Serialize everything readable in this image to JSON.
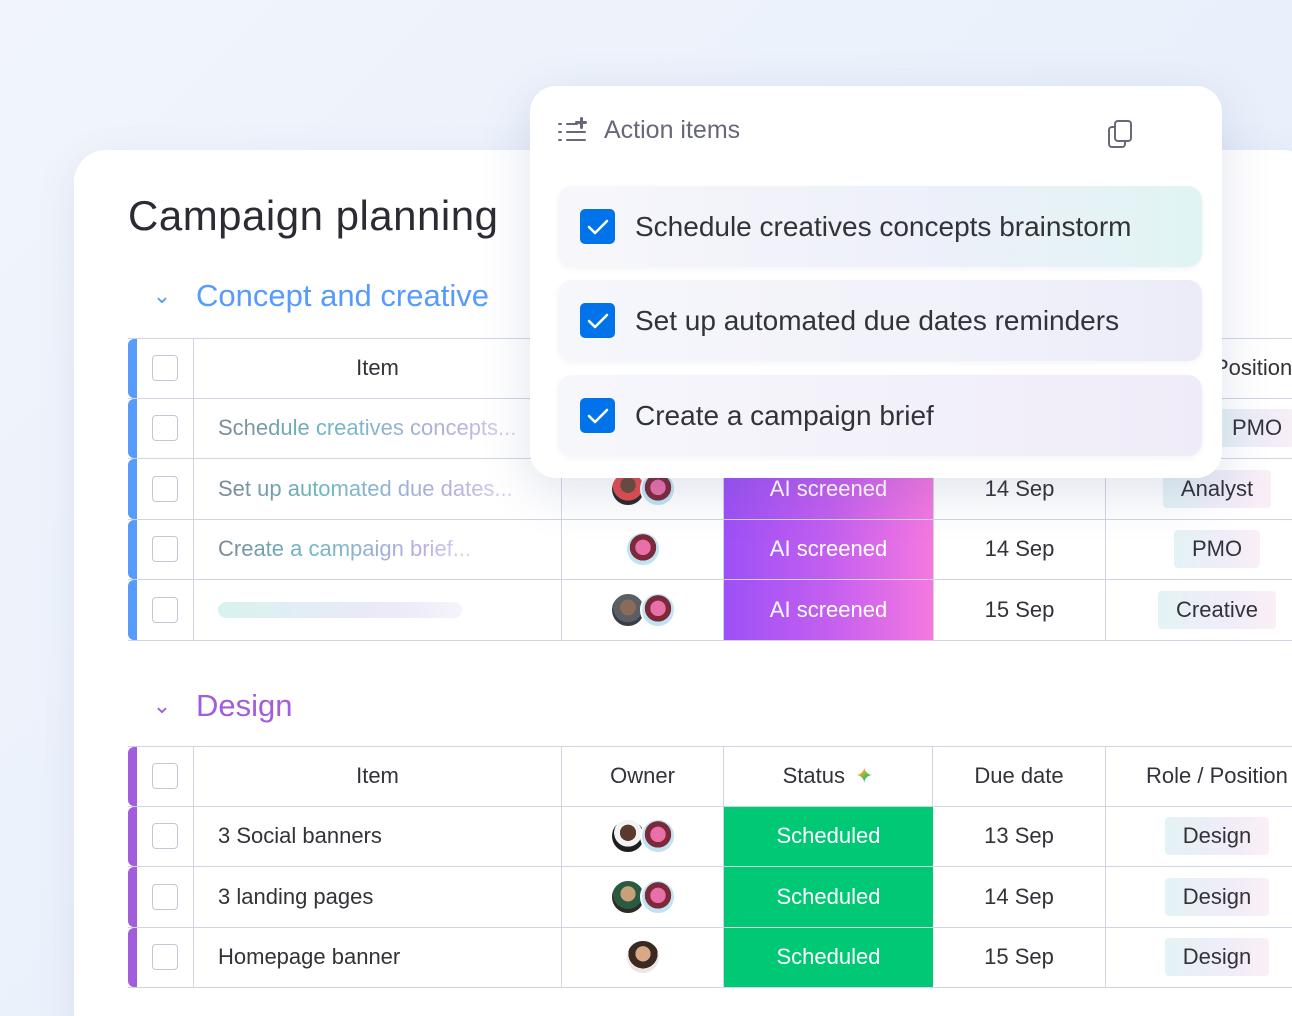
{
  "board": {
    "title": "Campaign planning"
  },
  "popup": {
    "title": "Action items",
    "items": [
      {
        "label": "Schedule creatives concepts brainstorm",
        "checked": true
      },
      {
        "label": "Set up automated due dates reminders",
        "checked": true
      },
      {
        "label": "Create a campaign brief",
        "checked": true
      }
    ]
  },
  "groups": [
    {
      "name": "Concept and creative",
      "color": "#579bfc",
      "columns": {
        "item": "Item",
        "position": "Position"
      },
      "rows": [
        {
          "item": "Schedule creatives concepts...",
          "status": "",
          "due": "",
          "role": "PMO"
        },
        {
          "item": "Set up automated due dates...",
          "status": "AI screened",
          "due": "14 Sep",
          "role": "Analyst"
        },
        {
          "item": "Create a campaign brief...",
          "status": "AI screened",
          "due": "14 Sep",
          "role": "PMO"
        },
        {
          "item": "",
          "status": "AI screened",
          "due": "15 Sep",
          "role": "Creative"
        }
      ]
    },
    {
      "name": "Design",
      "color": "#a25ddc",
      "columns": {
        "item": "Item",
        "owner": "Owner",
        "status": "Status",
        "due": "Due date",
        "role": "Role / Position"
      },
      "rows": [
        {
          "item": "3 Social banners",
          "status": "Scheduled",
          "due": "13 Sep",
          "role": "Design"
        },
        {
          "item": "3 landing pages",
          "status": "Scheduled",
          "due": "14 Sep",
          "role": "Design"
        },
        {
          "item": "Homepage banner",
          "status": "Scheduled",
          "due": "15 Sep",
          "role": "Design"
        }
      ]
    }
  ],
  "colors": {
    "ai_status": "#9d50f6",
    "scheduled": "#00c875",
    "checkbox": "#0073ea"
  },
  "icons": [
    "chevron-down-icon",
    "list-sparkle-icon",
    "copy-icon",
    "checkbox-checked-icon",
    "sparkle-icon",
    "avatar"
  ]
}
